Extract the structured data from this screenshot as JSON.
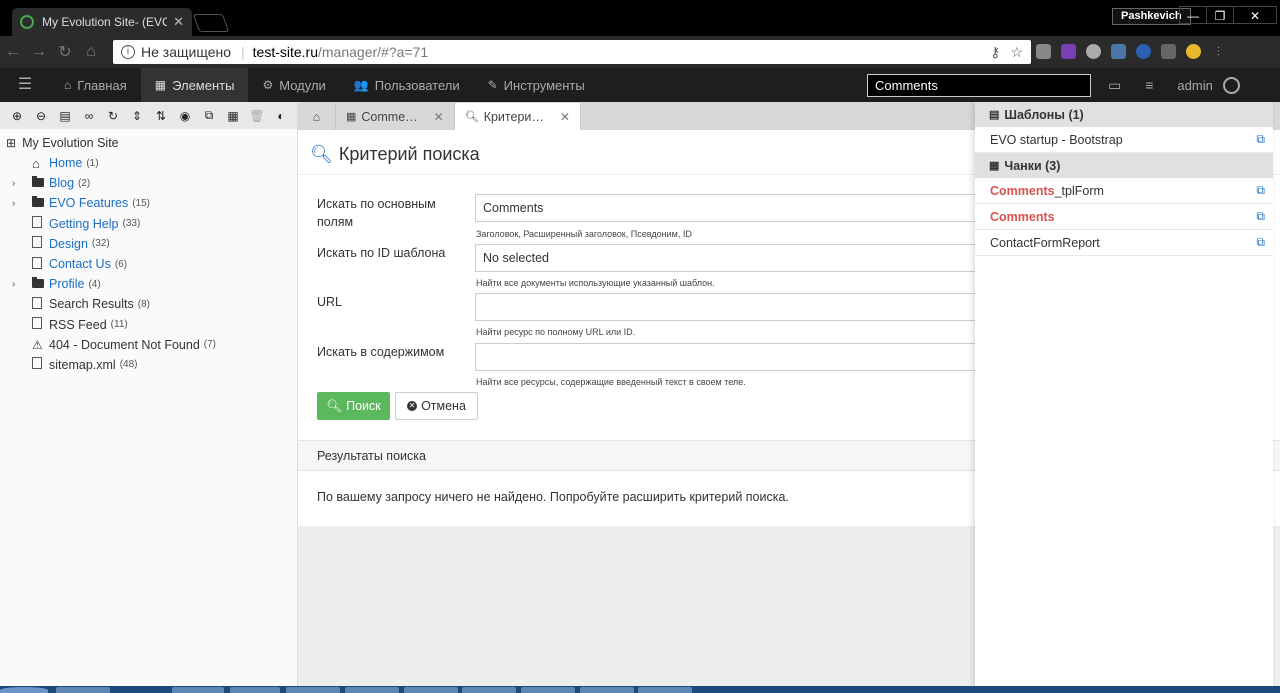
{
  "browser": {
    "tab_title": "My Evolution Site- (EVO",
    "tab_close": "✕",
    "profile_name": "Pashkevich",
    "security_label": "Не защищено",
    "url_host": "test-site.ru",
    "url_path": "/manager/#?a=71"
  },
  "topnav": {
    "items": [
      {
        "label": "Главная",
        "icon": "home-icon"
      },
      {
        "label": "Элементы",
        "icon": "grid-icon"
      },
      {
        "label": "Модули",
        "icon": "cogs-icon"
      },
      {
        "label": "Пользователи",
        "icon": "users-icon"
      },
      {
        "label": "Инструменты",
        "icon": "wrench-icon"
      }
    ],
    "search_value": "Comments",
    "user": "admin"
  },
  "tree": {
    "root": "My Evolution Site",
    "nodes": [
      {
        "label": "Home",
        "count": "(1)",
        "icon": "home-icon",
        "caret": false,
        "link": true
      },
      {
        "label": "Blog",
        "count": "(2)",
        "icon": "folder-icon",
        "caret": true,
        "link": true
      },
      {
        "label": "EVO Features",
        "count": "(15)",
        "icon": "folder-icon",
        "caret": true,
        "link": true
      },
      {
        "label": "Getting Help",
        "count": "(33)",
        "icon": "document-icon",
        "caret": false,
        "link": true
      },
      {
        "label": "Design",
        "count": "(32)",
        "icon": "document-icon",
        "caret": false,
        "link": true
      },
      {
        "label": "Contact Us",
        "count": "(6)",
        "icon": "document-icon",
        "caret": false,
        "link": true
      },
      {
        "label": "Profile",
        "count": "(4)",
        "icon": "folder-icon",
        "caret": true,
        "link": true
      },
      {
        "label": "Search Results",
        "count": "(8)",
        "icon": "document-icon",
        "caret": false,
        "link": false
      },
      {
        "label": "RSS Feed",
        "count": "(11)",
        "icon": "code-document-icon",
        "caret": false,
        "link": false
      },
      {
        "label": "404 - Document Not Found",
        "count": "(7)",
        "icon": "warning-icon",
        "caret": false,
        "link": false
      },
      {
        "label": "sitemap.xml",
        "count": "(48)",
        "icon": "code-document-icon",
        "caret": false,
        "link": false
      }
    ]
  },
  "tabs": [
    {
      "label": "Comme…",
      "close": "✕"
    },
    {
      "label": "Критери…",
      "close": "✕"
    }
  ],
  "search_form": {
    "title": "Критерий поиска",
    "fields": [
      {
        "label": "Искать по основным полям",
        "value": "Comments",
        "help": "Заголовок, Расширенный заголовок, Псевдоним, ID"
      },
      {
        "label": "Искать по ID шаблона",
        "value": "No selected",
        "help": "Найти все документы использующие указанный шаблон."
      },
      {
        "label": "URL",
        "value": "",
        "help": "Найти ресурс по полному URL или ID."
      },
      {
        "label": "Искать в содержимом",
        "value": "",
        "help": "Найти все ресурсы, содержащие введенный текст в своем теле."
      }
    ],
    "search_button": "Поиск",
    "cancel_button": "Отмена"
  },
  "results": {
    "title": "Результаты поиска",
    "message": "По вашему запросу ничего не найдено. Попробуйте расширить критерий поиска."
  },
  "right_panel": {
    "templates_title": "Шаблоны (1)",
    "templates": [
      "EVO startup - Bootstrap"
    ],
    "chunks_title": "Чанки (3)",
    "chunks": [
      {
        "highlight": "Comments",
        "rest": "_tplForm"
      },
      {
        "highlight": "Comments",
        "rest": ""
      },
      {
        "highlight": "",
        "rest": "ContactFormReport"
      }
    ]
  },
  "colors": {
    "accent": "#1a6fc4",
    "success": "#5cb85c",
    "highlight": "#d9534f"
  }
}
